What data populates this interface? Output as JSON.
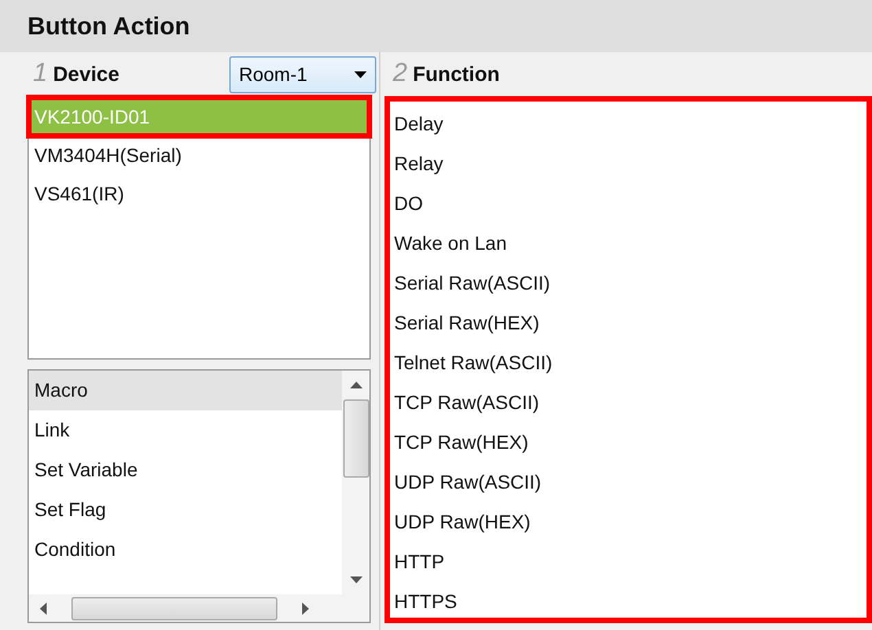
{
  "title": "Button Action",
  "device": {
    "step": "1",
    "label": "Device",
    "dropdown": "Room-1",
    "items": [
      {
        "label": "VK2100-ID01",
        "selected": true,
        "highlighted": true
      },
      {
        "label": "VM3404H(Serial)",
        "selected": false,
        "highlighted": false
      },
      {
        "label": "VS461(IR)",
        "selected": false,
        "highlighted": false
      }
    ]
  },
  "actions": {
    "items": [
      {
        "label": "Macro",
        "selected": true
      },
      {
        "label": "Link",
        "selected": false
      },
      {
        "label": "Set Variable",
        "selected": false
      },
      {
        "label": "Set Flag",
        "selected": false
      },
      {
        "label": "Condition",
        "selected": false
      }
    ]
  },
  "function": {
    "step": "2",
    "label": "Function",
    "highlighted": true,
    "items": [
      "Delay",
      "Relay",
      "DO",
      "Wake on Lan",
      "Serial Raw(ASCII)",
      "Serial Raw(HEX)",
      "Telnet Raw(ASCII)",
      "TCP Raw(ASCII)",
      "TCP Raw(HEX)",
      "UDP Raw(ASCII)",
      "UDP Raw(HEX)",
      "HTTP",
      "HTTPS"
    ]
  }
}
